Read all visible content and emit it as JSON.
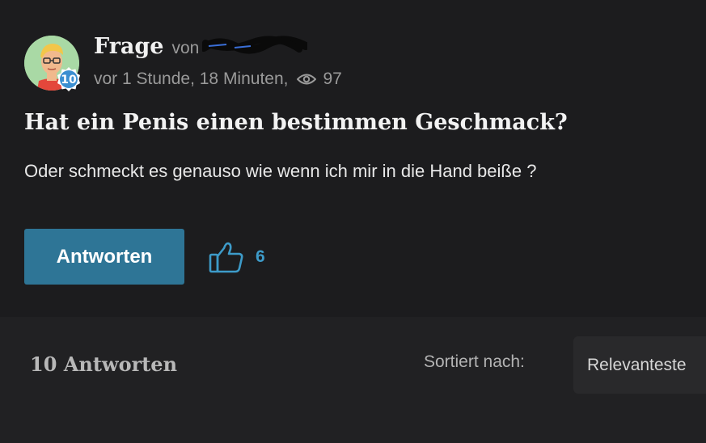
{
  "question": {
    "type_label": "Frage",
    "von_label": "von",
    "level_badge": "10",
    "timestamp": "vor 1 Stunde, 18 Minuten,",
    "views": "97",
    "title": "Hat ein Penis einen bestimmen Geschmack?",
    "body": "Oder schmeckt es genauso wie wenn ich mir in die Hand beiße ?",
    "answer_button_label": "Antworten",
    "like_count": "6"
  },
  "answers": {
    "count_label": "10 Antworten",
    "sort_label": "Sortiert nach:",
    "sort_value": "Relevanteste"
  },
  "colors": {
    "background": "#1c1c1e",
    "answers_bar": "#212123",
    "accent_button": "#2e7596",
    "accent_like": "#3d9bc9",
    "badge": "#3b8fd1"
  },
  "icons": {
    "avatar": "avatar-illustration",
    "badge": "level-badge-icon",
    "views": "eye-icon",
    "like": "thumbs-up-icon"
  }
}
